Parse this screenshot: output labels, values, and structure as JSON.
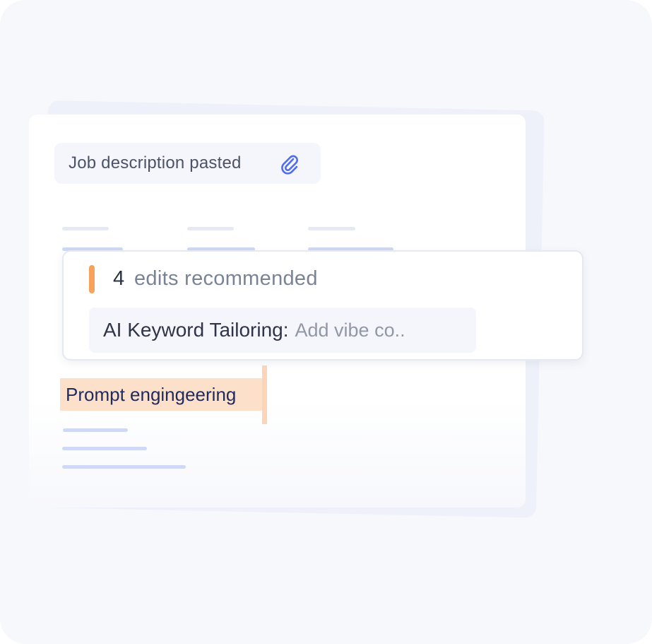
{
  "job_description": {
    "label": "Job description pasted",
    "icon": "paperclip-icon"
  },
  "recommendations": {
    "count": "4",
    "label": "edits recommended",
    "accent_color": "#f6a25a"
  },
  "keyword_tailoring": {
    "label": "AI Keyword Tailoring:",
    "value": "Add vibe co.."
  },
  "highlighted_skill": {
    "text": "Prompt engingeering",
    "highlight_color": "#fde0c9"
  }
}
